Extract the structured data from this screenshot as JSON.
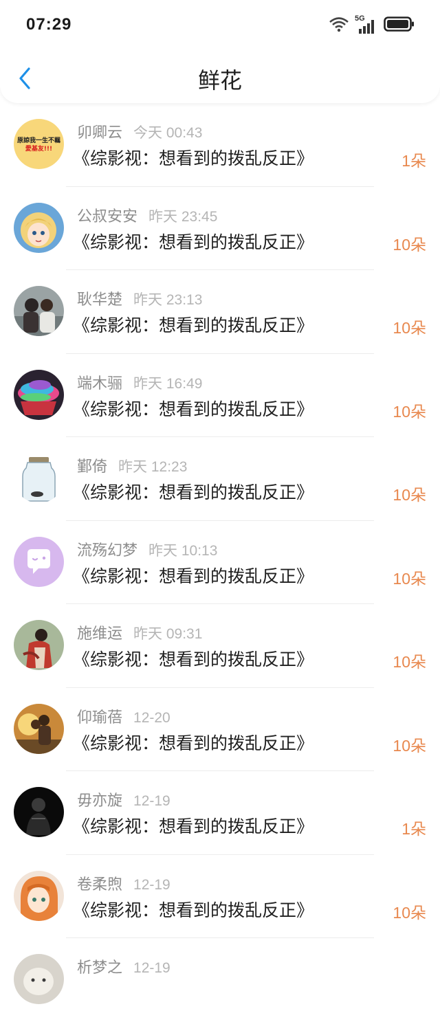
{
  "status": {
    "time": "07:29",
    "network": "5G"
  },
  "header": {
    "title": "鲜花"
  },
  "colors": {
    "accent_blue": "#1e90e8",
    "count_orange": "#e8884e"
  },
  "items": [
    {
      "name": "卯卿云",
      "date": "今天 00:43",
      "book": "《综影视：想看到的拨乱反正》",
      "count": "1朵",
      "avatar": "avatar-text-badge",
      "avatar_text_1": "原諒我一生不羈",
      "avatar_text_2": "愛基友!!!"
    },
    {
      "name": "公叔安安",
      "date": "昨天 23:45",
      "book": "《综影视：想看到的拨乱反正》",
      "count": "10朵",
      "avatar": "avatar-anime-girl"
    },
    {
      "name": "耿华楚",
      "date": "昨天 23:13",
      "book": "《综影视：想看到的拨乱反正》",
      "count": "10朵",
      "avatar": "avatar-couple-photo"
    },
    {
      "name": "端木骊",
      "date": "昨天 16:49",
      "book": "《综影视：想看到的拨乱反正》",
      "count": "10朵",
      "avatar": "avatar-cupcake"
    },
    {
      "name": "鄞倚",
      "date": "昨天 12:23",
      "book": "《综影视：想看到的拨乱反正》",
      "count": "10朵",
      "avatar": "avatar-jar"
    },
    {
      "name": "流殇幻梦",
      "date": "昨天 10:13",
      "book": "《综影视：想看到的拨乱反正》",
      "count": "10朵",
      "avatar": "avatar-default-chat"
    },
    {
      "name": "施维运",
      "date": "昨天 09:31",
      "book": "《综影视：想看到的拨乱反正》",
      "count": "10朵",
      "avatar": "avatar-costume-figure"
    },
    {
      "name": "仰瑜蓓",
      "date": "12-20",
      "book": "《综影视：想看到的拨乱反正》",
      "count": "10朵",
      "avatar": "avatar-sunset-couple"
    },
    {
      "name": "毋亦旋",
      "date": "12-19",
      "book": "《综影视：想看到的拨乱反正》",
      "count": "1朵",
      "avatar": "avatar-dark-figure"
    },
    {
      "name": "卷柔煦",
      "date": "12-19",
      "book": "《综影视：想看到的拨乱反正》",
      "count": "10朵",
      "avatar": "avatar-anime-orange-hair"
    },
    {
      "name": "析梦之",
      "date": "12-19",
      "book": "",
      "count": "",
      "avatar": "avatar-pet-photo"
    }
  ]
}
